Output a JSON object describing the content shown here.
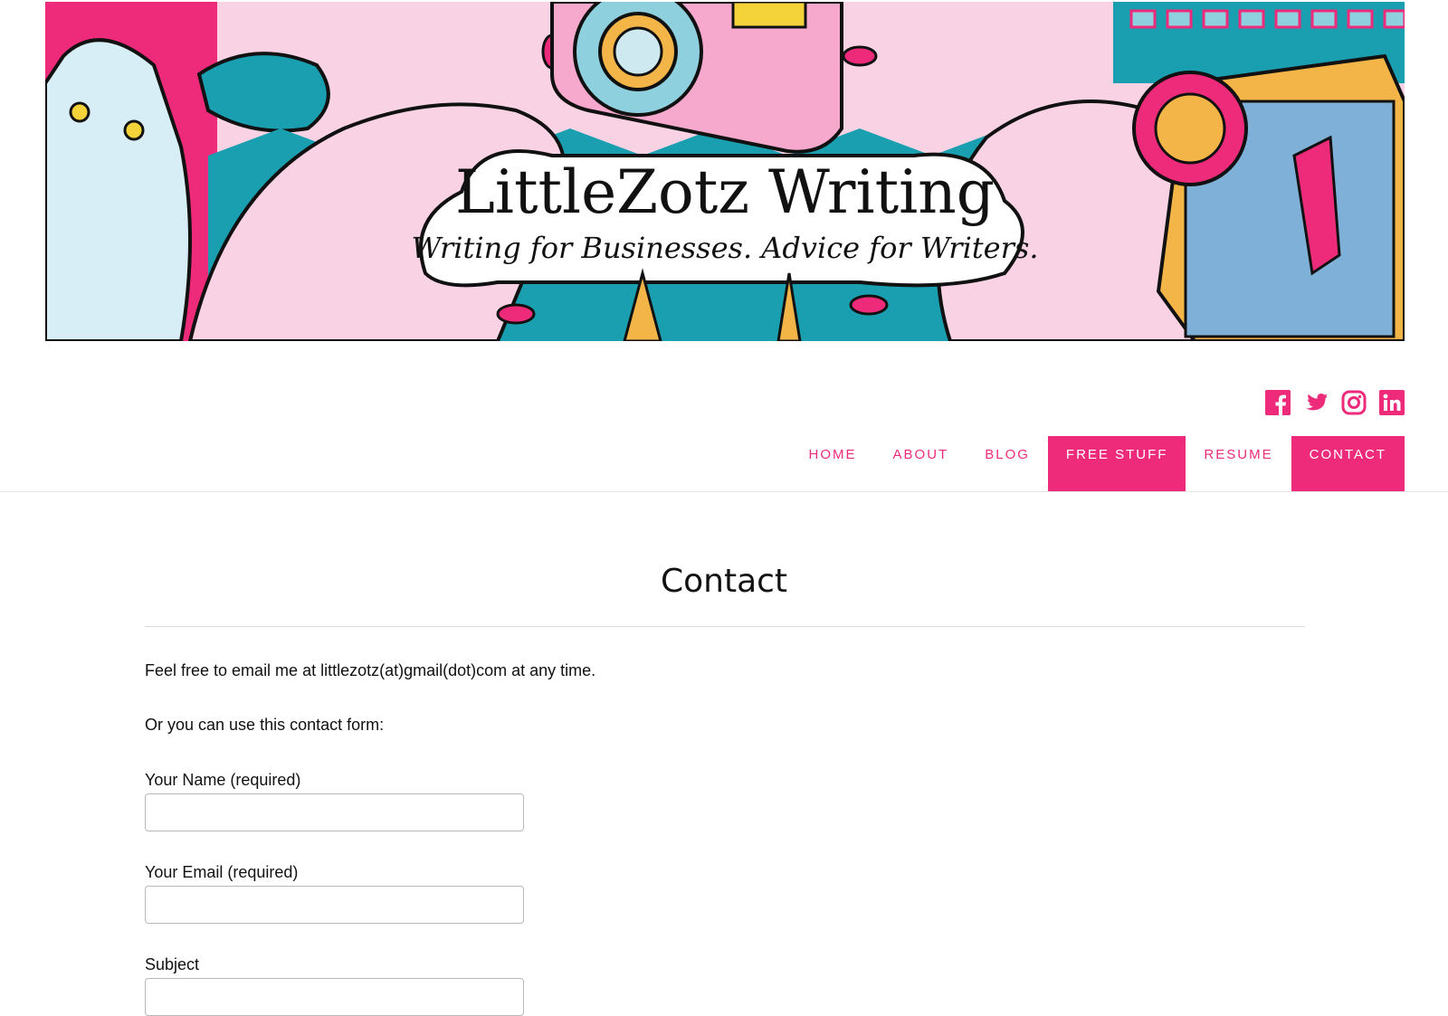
{
  "header": {
    "site_title": "LittleZotz Writing",
    "tagline": "Writing for Businesses. Advice for Writers."
  },
  "social": {
    "icons": [
      "facebook-icon",
      "twitter-icon",
      "instagram-icon",
      "linkedin-icon"
    ],
    "color": "#ee2a7b"
  },
  "nav": {
    "items": [
      {
        "label": "HOME",
        "active": false
      },
      {
        "label": "ABOUT",
        "active": false
      },
      {
        "label": "BLOG",
        "active": false
      },
      {
        "label": "FREE STUFF",
        "active": true
      },
      {
        "label": "RESUME",
        "active": false
      },
      {
        "label": "CONTACT",
        "active": true
      }
    ],
    "accent_color": "#ee2a7b"
  },
  "main": {
    "title": "Contact",
    "intro": "Feel free to email me at littlezotz(at)gmail(dot)com at any time.",
    "form_intro": "Or you can use this contact form:",
    "form": {
      "name_label": "Your Name (required)",
      "name_value": "",
      "email_label": "Your Email (required)",
      "email_value": "",
      "subject_label": "Subject",
      "subject_value": ""
    }
  }
}
